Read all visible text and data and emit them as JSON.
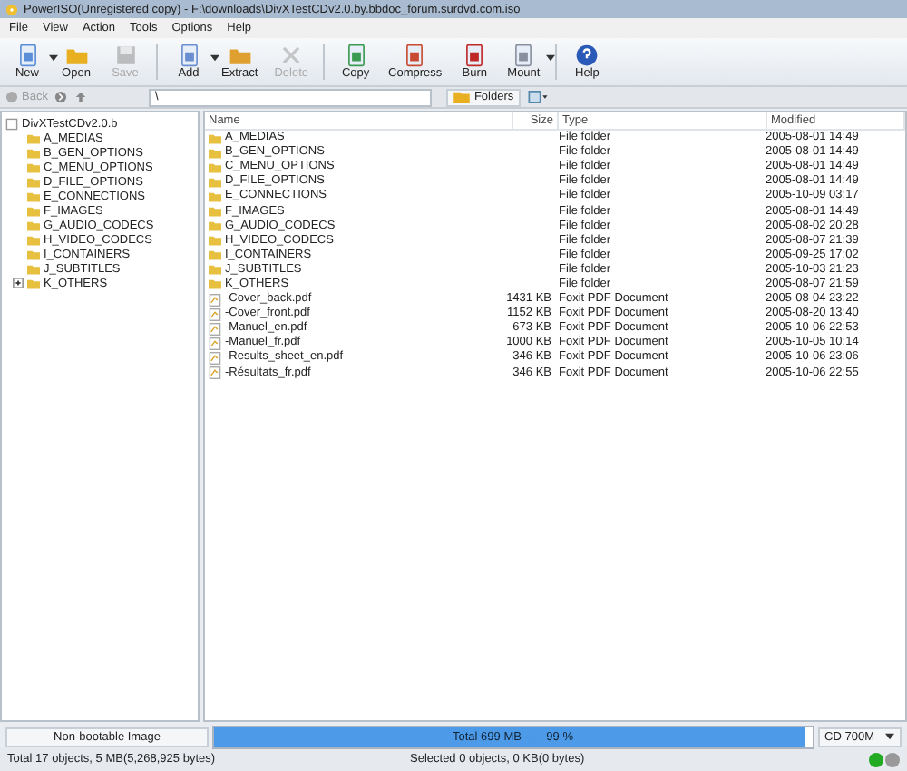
{
  "window": {
    "title": "PowerISO(Unregistered copy) - F:\\downloads\\DivXTestCDv2.0.by.bbdoc_forum.surdvd.com.iso"
  },
  "menu": [
    "File",
    "View",
    "Action",
    "Tools",
    "Options",
    "Help"
  ],
  "toolbar": [
    {
      "label": "New",
      "kind": "new",
      "disabled": false,
      "dropdown": true
    },
    {
      "label": "Open",
      "kind": "open",
      "disabled": false,
      "dropdown": false
    },
    {
      "label": "Save",
      "kind": "save",
      "disabled": true,
      "dropdown": false
    },
    {
      "label": "Add",
      "kind": "add",
      "disabled": false,
      "dropdown": true
    },
    {
      "label": "Extract",
      "kind": "extract",
      "disabled": false,
      "dropdown": false
    },
    {
      "label": "Delete",
      "kind": "delete",
      "disabled": true,
      "dropdown": false
    },
    {
      "label": "Copy",
      "kind": "copy",
      "disabled": false,
      "dropdown": false
    },
    {
      "label": "Compress",
      "kind": "compress",
      "disabled": false,
      "dropdown": false
    },
    {
      "label": "Burn",
      "kind": "burn",
      "disabled": false,
      "dropdown": false
    },
    {
      "label": "Mount",
      "kind": "mount",
      "disabled": false,
      "dropdown": true
    },
    {
      "label": "Help",
      "kind": "help",
      "disabled": false,
      "dropdown": false
    }
  ],
  "navbar": {
    "back": {
      "label": "Back",
      "disabled": true
    },
    "path": "\\",
    "folders_button": "Folders"
  },
  "tree": [
    {
      "label": "DivXTestCDv2.0.b",
      "children": [
        {
          "label": "A_MEDIAS"
        },
        {
          "label": "B_GEN_OPTIONS"
        },
        {
          "label": "C_MENU_OPTIONS"
        },
        {
          "label": "D_FILE_OPTIONS"
        },
        {
          "label": "E_CONNECTIONS"
        },
        {
          "label": "F_IMAGES"
        },
        {
          "label": "G_AUDIO_CODECS"
        },
        {
          "label": "H_VIDEO_CODECS"
        },
        {
          "label": "I_CONTAINERS"
        },
        {
          "label": "J_SUBTITLES"
        },
        {
          "label": "K_OTHERS",
          "expanded": false
        }
      ]
    }
  ],
  "table": {
    "columns": [
      "Name",
      "Size",
      "Type",
      "Modified"
    ],
    "rows": [
      {
        "kind": "folder",
        "name": "A_MEDIAS",
        "size": "",
        "type": "File folder",
        "modified": "2005-08-01 14:49"
      },
      {
        "kind": "folder",
        "name": "B_GEN_OPTIONS",
        "size": "",
        "type": "File folder",
        "modified": "2005-08-01 14:49"
      },
      {
        "kind": "folder",
        "name": "C_MENU_OPTIONS",
        "size": "",
        "type": "File folder",
        "modified": "2005-08-01 14:49"
      },
      {
        "kind": "folder",
        "name": "D_FILE_OPTIONS",
        "size": "",
        "type": "File folder",
        "modified": "2005-08-01 14:49"
      },
      {
        "kind": "folder",
        "name": "E_CONNECTIONS",
        "size": "",
        "type": "File folder",
        "modified": "2005-10-09 03:17"
      },
      {
        "kind": "folder",
        "name": "F_IMAGES",
        "size": "",
        "type": "File folder",
        "modified": "2005-08-01 14:49"
      },
      {
        "kind": "folder",
        "name": "G_AUDIO_CODECS",
        "size": "",
        "type": "File folder",
        "modified": "2005-08-02 20:28"
      },
      {
        "kind": "folder",
        "name": "H_VIDEO_CODECS",
        "size": "",
        "type": "File folder",
        "modified": "2005-08-07 21:39"
      },
      {
        "kind": "folder",
        "name": "I_CONTAINERS",
        "size": "",
        "type": "File folder",
        "modified": "2005-09-25 17:02"
      },
      {
        "kind": "folder",
        "name": "J_SUBTITLES",
        "size": "",
        "type": "File folder",
        "modified": "2005-10-03 21:23"
      },
      {
        "kind": "folder",
        "name": "K_OTHERS",
        "size": "",
        "type": "File folder",
        "modified": "2005-08-07 21:59"
      },
      {
        "kind": "pdf",
        "name": "-Cover_back.pdf",
        "size": "1431 KB",
        "type": "Foxit PDF Document",
        "modified": "2005-08-04 23:22"
      },
      {
        "kind": "pdf",
        "name": "-Cover_front.pdf",
        "size": "1152 KB",
        "type": "Foxit PDF Document",
        "modified": "2005-08-20 13:40"
      },
      {
        "kind": "pdf",
        "name": "-Manuel_en.pdf",
        "size": "673 KB",
        "type": "Foxit PDF Document",
        "modified": "2005-10-06 22:53"
      },
      {
        "kind": "pdf",
        "name": "-Manuel_fr.pdf",
        "size": "1000 KB",
        "type": "Foxit PDF Document",
        "modified": "2005-10-05 10:14"
      },
      {
        "kind": "pdf",
        "name": "-Results_sheet_en.pdf",
        "size": "346 KB",
        "type": "Foxit PDF Document",
        "modified": "2005-10-06 23:06"
      },
      {
        "kind": "pdf",
        "name": "-Résultats_fr.pdf",
        "size": "346 KB",
        "type": "Foxit PDF Document",
        "modified": "2005-10-06 22:55"
      }
    ]
  },
  "capacity_bar": {
    "boot_label": "Non-bootable Image",
    "text": "Total 699 MB  - - -  99 %",
    "level": 0.99,
    "media": "CD 700M"
  },
  "status_bar": {
    "total": "Total 17 objects, 5 MB(5,268,925 bytes)",
    "selected": "Selected 0 objects, 0 KB(0 bytes)",
    "lights": [
      {
        "color": "#22aa22"
      },
      {
        "color": "#999999"
      }
    ]
  }
}
